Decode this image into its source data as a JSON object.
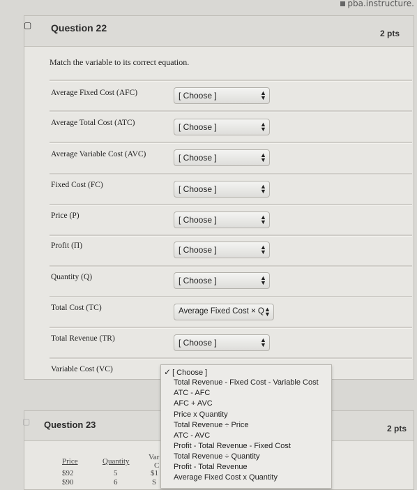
{
  "browser": {
    "url": "pba.instructure."
  },
  "question22": {
    "title": "Question 22",
    "points": "2 pts",
    "prompt": "Match the variable to its correct equation.",
    "rows": [
      {
        "label": "Average Fixed Cost (AFC)",
        "selected": "[ Choose ]"
      },
      {
        "label": "Average Total Cost (ATC)",
        "selected": "[ Choose ]"
      },
      {
        "label": "Average Variable Cost (AVC)",
        "selected": "[ Choose ]"
      },
      {
        "label": "Fixed Cost (FC)",
        "selected": "[ Choose ]"
      },
      {
        "label": "Price (P)",
        "selected": "[ Choose ]"
      },
      {
        "label": "Profit (Π)",
        "selected": "[ Choose ]"
      },
      {
        "label": "Quantity (Q)",
        "selected": "[ Choose ]"
      },
      {
        "label": "Total Cost (TC)",
        "selected": "Average Fixed Cost × Q"
      },
      {
        "label": "Total Revenue (TR)",
        "selected": "[ Choose ]"
      },
      {
        "label": "Variable Cost (VC)",
        "selected": ""
      }
    ],
    "dropdown_options": [
      "[ Choose ]",
      "Total Revenue - Fixed Cost - Variable Cost",
      "ATC - AFC",
      "AFC + AVC",
      "Price x Quantity",
      "Total Revenue ÷ Price",
      "ATC - AVC",
      "Profit - Total Revenue - Fixed Cost",
      "Total Revenue ÷ Quantity",
      "Profit - Total Revenue",
      "Average Fixed Cost x Quantity"
    ],
    "dropdown_checked": "✓"
  },
  "question23": {
    "title": "Question 23",
    "points": "2 pts",
    "headers": [
      "Price",
      "Quantity",
      "Var"
    ],
    "cells": [
      "$92",
      "5",
      "$1",
      "$90",
      "6",
      "C",
      "S"
    ]
  }
}
